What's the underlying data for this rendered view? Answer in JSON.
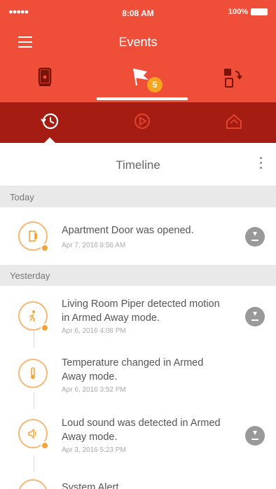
{
  "status_bar": {
    "carrier": "●●●●● ",
    "time": "8:08 AM",
    "battery": "100%"
  },
  "navbar": {
    "title": "Events"
  },
  "tabs": {
    "items": [
      {
        "icon": "door-sensor-icon",
        "active": false
      },
      {
        "icon": "flag-icon",
        "active": true,
        "badge": "5"
      },
      {
        "icon": "rules-icon",
        "active": false
      }
    ]
  },
  "subtabs": {
    "items": [
      {
        "icon": "history-clock-icon",
        "active": true
      },
      {
        "icon": "play-video-icon",
        "active": false
      },
      {
        "icon": "home-mode-icon",
        "active": false
      }
    ]
  },
  "header": {
    "title": "Timeline"
  },
  "sections": [
    {
      "label": "Today",
      "events": [
        {
          "icon": "door-icon",
          "title": "Apartment Door was opened.",
          "time": "Apr 7, 2016 8:56 AM",
          "download": true
        }
      ]
    },
    {
      "label": "Yesterday",
      "events": [
        {
          "icon": "motion-icon",
          "title": "Living Room Piper detected motion in Armed Away mode.",
          "time": "Apr 6, 2016 4:08 PM",
          "download": true
        },
        {
          "icon": "thermometer-icon",
          "title": "Temperature changed in Armed Away mode.",
          "time": "Apr 6, 2016 3:52 PM",
          "download": false
        },
        {
          "icon": "sound-icon",
          "title": "Loud sound was detected in Armed Away mode.",
          "time": "Apr 3, 2016 5:23 PM",
          "download": true
        },
        {
          "icon": "alert-icon",
          "title": "System Alert",
          "time": "",
          "download": false
        }
      ]
    }
  ],
  "colors": {
    "primary": "#ef4f38",
    "primary_dark": "#a51c12",
    "accent": "#f7a41f",
    "icon_ring": "#f5b878"
  }
}
